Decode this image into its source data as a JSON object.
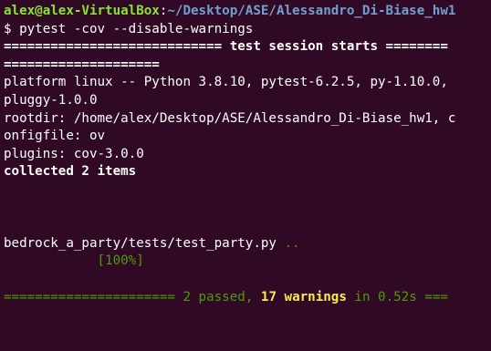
{
  "prompt": {
    "user_host": "alex@alex-VirtualBox",
    "separator": ":",
    "path": "~/Desktop/ASE/Alessandro_Di-Biase_hw1",
    "symbol": "$",
    "command": "pytest -cov --disable-warnings"
  },
  "session": {
    "header_left": "============================ ",
    "header_title": "test session starts",
    "header_right": " ========",
    "header_wrap": "====================",
    "platform": "platform linux -- Python 3.8.10, pytest-6.2.5, py-1.10.0,",
    "pluggy": "pluggy-1.0.0",
    "rootdir": "rootdir: /home/alex/Desktop/ASE/Alessandro_Di-Biase_hw1, c",
    "configfile": "onfigfile: ov",
    "plugins": "plugins: cov-3.0.0",
    "collected": "collected 2 items"
  },
  "result": {
    "test_file": "bedrock_a_party/tests/test_party.py",
    "dots": " ..",
    "progress": "[100%]"
  },
  "summary": {
    "left_bar": "====================== ",
    "passed": "2 passed",
    "comma": ", ",
    "warnings": "17 warnings",
    "time": " in 0.52s ",
    "right_bar": "==="
  },
  "colors": {
    "background": "#300a24",
    "text": "#ffffff",
    "prompt_user": "#8ae234",
    "prompt_path": "#729fcf",
    "pass": "#4e9a06",
    "warning": "#fce94f"
  }
}
